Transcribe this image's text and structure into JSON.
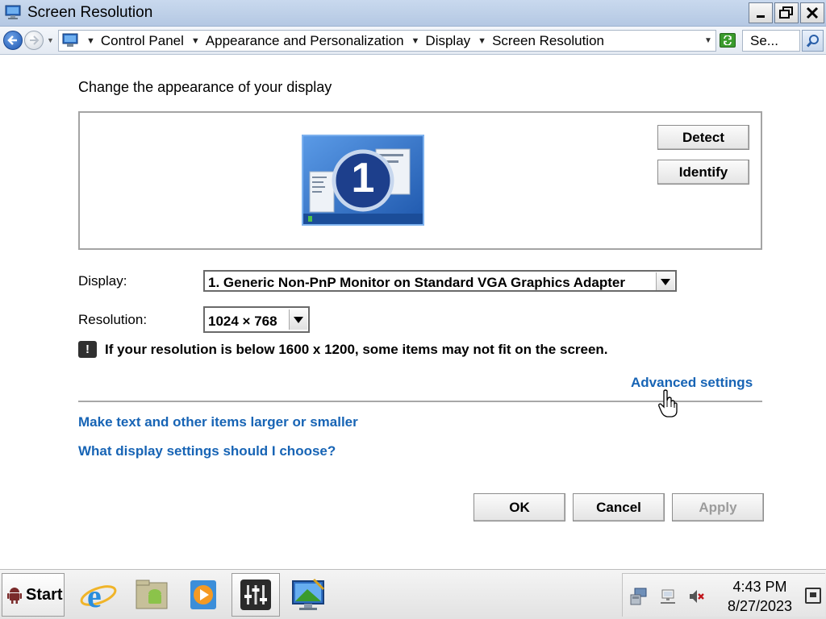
{
  "window": {
    "title": "Screen Resolution",
    "buttons": {
      "minimize": "minimize-icon",
      "maximize": "restore-icon",
      "close": "close-icon"
    }
  },
  "addressbar": {
    "breadcrumbs": [
      "Control Panel",
      "Appearance and Personalization",
      "Display",
      "Screen Resolution"
    ],
    "search_text": "Se..."
  },
  "main": {
    "heading": "Change the appearance of your display",
    "monitor_number": "1",
    "detect_label": "Detect",
    "identify_label": "Identify",
    "display_label": "Display:",
    "display_value": "1. Generic Non-PnP Monitor on Standard VGA Graphics Adapter",
    "resolution_label": "Resolution:",
    "resolution_value": "1024 × 768",
    "warning_text": "If your resolution is below 1600 x 1200, some items may not fit on the screen.",
    "advanced_link": "Advanced settings",
    "larger_link": "Make text and other items larger or smaller",
    "choose_link": "What display settings should I choose?",
    "ok_label": "OK",
    "cancel_label": "Cancel",
    "apply_label": "Apply"
  },
  "taskbar": {
    "start_label": "Start",
    "apps": [
      "internet-explorer-icon",
      "file-manager-icon",
      "media-player-icon",
      "mixer-icon",
      "display-settings-icon"
    ],
    "time": "4:43 PM",
    "date": "8/27/2023"
  },
  "colors": {
    "link": "#1764b5",
    "titlebar": "#b4c8e3",
    "monitor_blue": "#3a7fd5",
    "disabled_text": "#9c9c9c"
  }
}
